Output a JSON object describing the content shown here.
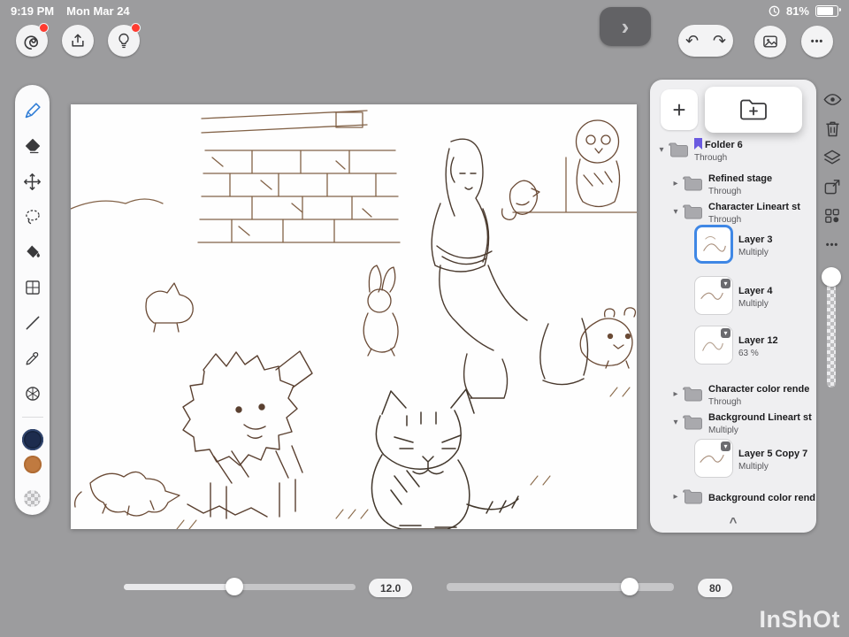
{
  "status_bar": {
    "time": "9:19 PM",
    "date": "Mon Mar 24",
    "battery_percent": "81%"
  },
  "glyphs": {
    "plus": "+",
    "undo": "↶",
    "redo": "↷",
    "more_dots": "•••",
    "handle_chevron": "›",
    "rail_ellipsis": "•••",
    "scroll_up": "^"
  },
  "colors": {
    "primary_swatch": "#1d2c4e",
    "secondary_swatch": "#c07a40",
    "selection_blue": "#3f87e5",
    "notification_red": "#ff3b30",
    "folder_tag_purple": "#6a5ae0"
  },
  "left_tools": [
    "pen",
    "eraser",
    "move",
    "lasso",
    "fill",
    "transform-grid",
    "line",
    "eyedropper",
    "symmetry"
  ],
  "layers_panel": {
    "rows": [
      {
        "type": "folder",
        "label": "Folder 6",
        "mode": "Through",
        "chevron": "▾",
        "tagged": true
      },
      {
        "type": "folder",
        "label": "Refined stage",
        "mode": "Through",
        "chevron": "▸"
      },
      {
        "type": "folder",
        "label": "Character Lineart st",
        "mode": "Through",
        "chevron": "▾"
      },
      {
        "type": "layer",
        "label": "Layer 3",
        "mode": "Multiply",
        "selected": true
      },
      {
        "type": "layer",
        "label": "Layer 4",
        "mode": "Multiply",
        "badge": true
      },
      {
        "type": "layer",
        "label": "Layer 12",
        "mode": "63 %",
        "badge": true
      },
      {
        "type": "folder",
        "label": "Character color rende",
        "mode": "Through",
        "chevron": "▸"
      },
      {
        "type": "folder",
        "label": "Background Lineart st",
        "mode": "Multiply",
        "chevron": "▾"
      },
      {
        "type": "layer",
        "label": "Layer 5 Copy 7",
        "mode": "Multiply",
        "badge": true
      },
      {
        "type": "folder",
        "label": "Background color rend",
        "mode": "",
        "chevron": "▸"
      }
    ]
  },
  "sliders": {
    "brush_size_value": "12.0",
    "opacity_value": "80"
  },
  "watermark": "InShOt"
}
